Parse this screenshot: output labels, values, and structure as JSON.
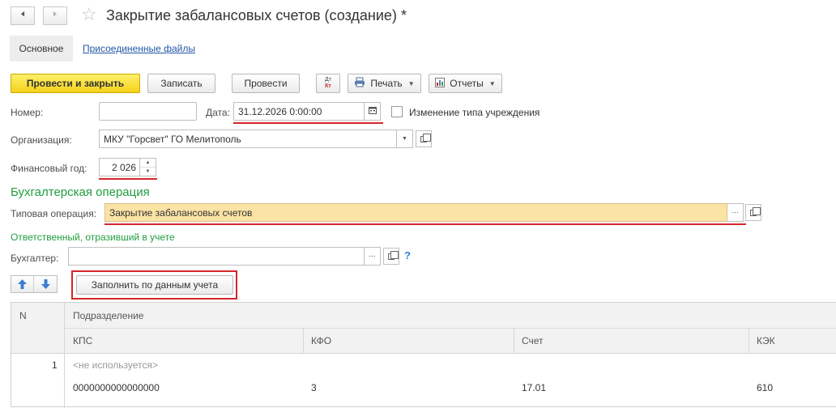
{
  "window": {
    "title": "Закрытие забалансовых счетов (создание) *"
  },
  "tabs": {
    "main": "Основное",
    "files": "Присоединенные файлы"
  },
  "toolbar": {
    "post_close": "Провести и закрыть",
    "save": "Записать",
    "post": "Провести",
    "dtkt_top": "Дт",
    "dtkt_bottom": "Кт",
    "print": "Печать",
    "reports": "Отчеты"
  },
  "form": {
    "number_label": "Номер:",
    "number_value": "",
    "date_label": "Дата:",
    "date_value": "31.12.2026  0:00:00",
    "change_type_label": "Изменение типа учреждения",
    "change_type_checked": false,
    "org_label": "Организация:",
    "org_value": "МКУ \"Горсвет\" ГО Мелитополь",
    "fin_year_label": "Финансовый год:",
    "fin_year_value": "2 026",
    "section_operation": "Бухгалтерская операция",
    "typical_op_label": "Типовая операция:",
    "typical_op_value": "Закрытие забалансовых счетов",
    "responsible_section": "Ответственный, отразивший в учете",
    "accountant_label": "Бухгалтер:",
    "accountant_value": "",
    "help": "?",
    "fill_button": "Заполнить по данным учета"
  },
  "table": {
    "headers": {
      "n": "N",
      "subdivision": "Подразделение",
      "kps": "КПС",
      "kfo": "КФО",
      "account": "Счет",
      "kek": "КЭК"
    },
    "rows": [
      {
        "n": "1",
        "subdivision": "<не используется>",
        "kps": "0000000000000000",
        "kfo": "3",
        "account": "17.01",
        "kek": "610"
      }
    ]
  },
  "colors": {
    "primary_button": "#f4d21b",
    "highlight_field": "#fbe3a6",
    "section_green": "#1f9e3e",
    "annotation_red": "#d4262b",
    "link_blue": "#2256a8"
  }
}
